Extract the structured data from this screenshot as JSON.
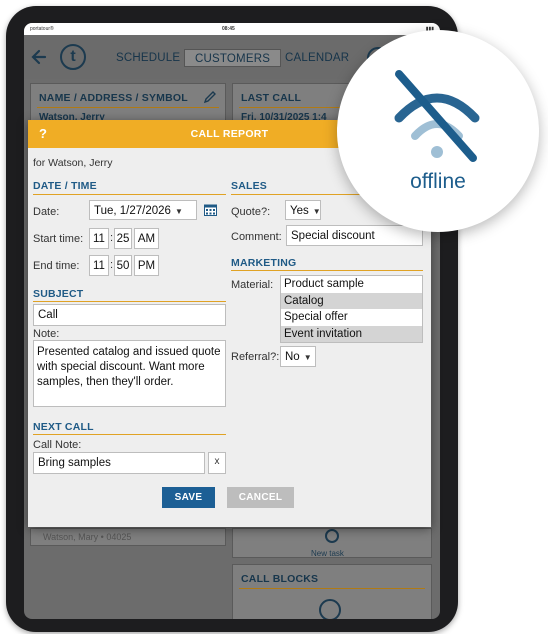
{
  "status_bar": {
    "carrier": "portatour®",
    "time": "08:45",
    "battery": "▮▮▮"
  },
  "nav": {
    "tabs": [
      "SCHEDULE",
      "CUSTOMERS",
      "CALENDAR"
    ],
    "active_tab": "CUSTOMERS",
    "help": "?"
  },
  "logo": "t",
  "panels": {
    "name_header": "NAME / ADDRESS / SYMBOL",
    "name_value": "Watson, Jerry",
    "last_call_header": "LAST CALL",
    "last_call_value": "Fri, 10/31/2025 1:4",
    "new_task_label": "New task",
    "call_blocks_header": "CALL BLOCKS",
    "left_dim_text": "Watson, Mary • 04025"
  },
  "dialog": {
    "help": "?",
    "title": "CALL REPORT",
    "for_line": "for Watson, Jerry",
    "date_time": {
      "header": "DATE / TIME",
      "date_label": "Date:",
      "date_value": "Tue, 1/27/2026",
      "start_label": "Start time:",
      "start_hour": "11",
      "start_min": "25",
      "start_ampm": "AM",
      "end_label": "End time:",
      "end_hour": "11",
      "end_min": "50",
      "end_ampm": "PM",
      "colon": ":"
    },
    "subject": {
      "header": "SUBJECT",
      "value": "Call",
      "note_label": "Note:",
      "note_value": "Presented catalog and issued quote with special discount. Want more samples, then they'll order."
    },
    "next_call": {
      "header": "NEXT CALL",
      "note_label": "Call Note:",
      "note_value": "Bring samples",
      "clear": "x"
    },
    "sales": {
      "header": "SALES",
      "quote_label": "Quote?:",
      "quote_value": "Yes",
      "comment_label": "Comment:",
      "comment_value": "Special discount"
    },
    "marketing": {
      "header": "MARKETING",
      "material_label": "Material:",
      "materials": [
        {
          "label": "Product sample",
          "selected": false
        },
        {
          "label": "Catalog",
          "selected": true
        },
        {
          "label": "Special offer",
          "selected": false
        },
        {
          "label": "Event invitation",
          "selected": true
        }
      ],
      "referral_label": "Referral?:",
      "referral_value": "No"
    },
    "save_label": "SAVE",
    "cancel_label": "CANCEL"
  },
  "offline": {
    "label": "offline",
    "icon": "wifi-off-icon"
  },
  "colors": {
    "accent": "#f0ad25",
    "primary": "#1c5f95",
    "section": "#1f5a86"
  }
}
